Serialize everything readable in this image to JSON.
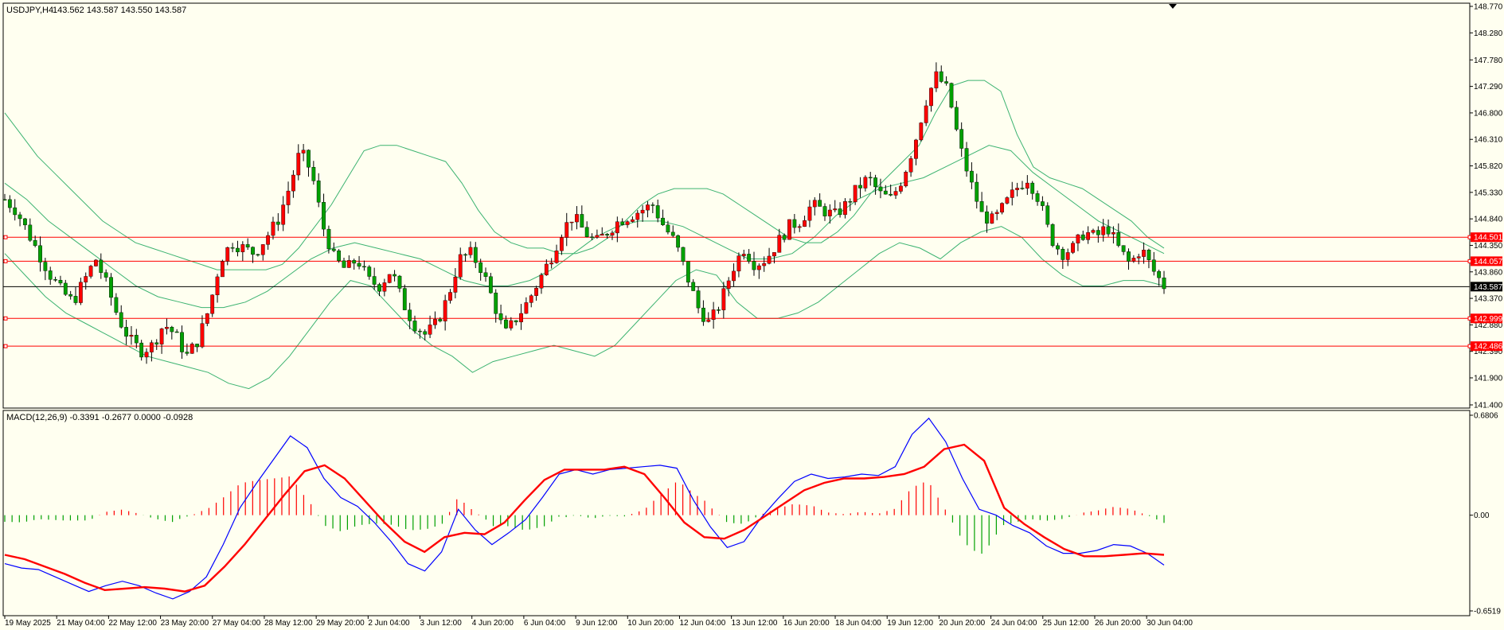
{
  "header": {
    "symbol_text": "USDJPY,H4",
    "ohlc_text": "143.562 143.587 143.550 143.587"
  },
  "macd_header": {
    "text": "MACD(12,26,9) -0.3391 -0.2677 0.0000 -0.0928"
  },
  "colors": {
    "background": "#fffff0",
    "bull_candle": "#ff0000",
    "bear_candle": "#00a000",
    "bands": "#3cb371",
    "levels": "#ff0000",
    "price_line": "#000000",
    "macd_line": "#0000ff",
    "signal_line": "#ff0000",
    "hist_positive": "#ff0000",
    "hist_negative": "#00a000"
  },
  "chart_data": [
    {
      "type": "candlestick",
      "title": "USDJPY,H4",
      "timeframe": "H4",
      "ylim": [
        141.4,
        148.77
      ],
      "y_ticks": [
        "148.770",
        "148.280",
        "147.780",
        "147.290",
        "146.800",
        "146.310",
        "145.820",
        "145.330",
        "144.840",
        "144.350",
        "143.860",
        "143.370",
        "142.880",
        "142.390",
        "141.900",
        "141.400"
      ],
      "x_ticks": [
        "19 May 2025",
        "21 May 04:00",
        "22 May 12:00",
        "23 May 20:00",
        "27 May 04:00",
        "28 May 12:00",
        "29 May 20:00",
        "2 Jun 04:00",
        "3 Jun 12:00",
        "4 Jun 20:00",
        "6 Jun 04:00",
        "9 Jun 12:00",
        "10 Jun 20:00",
        "12 Jun 04:00",
        "13 Jun 12:00",
        "16 Jun 20:00",
        "18 Jun 04:00",
        "19 Jun 12:00",
        "20 Jun 20:00",
        "24 Jun 04:00",
        "25 Jun 12:00",
        "26 Jun 20:00",
        "30 Jun 04:00"
      ],
      "levels": [
        {
          "price": 144.501,
          "label": "144.501"
        },
        {
          "price": 144.057,
          "label": "144.057"
        },
        {
          "price": 142.999,
          "label": "142.999"
        },
        {
          "price": 142.486,
          "label": "142.486"
        }
      ],
      "current_price": {
        "price": 143.587,
        "label": "143.587"
      },
      "price_path": [
        145.2,
        145.0,
        144.6,
        144.2,
        143.8,
        143.5,
        143.3,
        143.7,
        144.1,
        143.6,
        143.0,
        142.6,
        142.4,
        142.5,
        142.9,
        142.7,
        142.3,
        142.6,
        143.2,
        144.1,
        144.4,
        144.3,
        144.2,
        144.5,
        144.8,
        145.4,
        146.1,
        145.7,
        144.7,
        144.1,
        143.9,
        144.1,
        143.7,
        143.6,
        143.9,
        143.3,
        142.9,
        142.7,
        142.9,
        143.4,
        144.1,
        144.2,
        143.9,
        143.3,
        142.7,
        143.0,
        143.3,
        143.7,
        144.1,
        144.6,
        144.9,
        144.6,
        144.4,
        144.6,
        144.8,
        144.9,
        145.0,
        145.1,
        144.7,
        144.4,
        143.8,
        143.2,
        142.9,
        143.3,
        143.9,
        144.3,
        144.0,
        144.1,
        144.4,
        144.7,
        144.8,
        145.1,
        145.0,
        144.9,
        145.1,
        145.4,
        145.6,
        145.3,
        145.2,
        145.6,
        146.2,
        147.0,
        147.5,
        147.2,
        146.2,
        145.5,
        144.9,
        144.8,
        145.1,
        145.4,
        145.6,
        145.2,
        144.5,
        144.2,
        144.3,
        144.6,
        144.5,
        144.7,
        144.3,
        144.0,
        144.3,
        143.9,
        143.6
      ],
      "bollinger": {
        "upper_path": [
          146.8,
          146.4,
          146.0,
          145.7,
          145.4,
          145.1,
          144.8,
          144.6,
          144.4,
          144.3,
          144.2,
          144.1,
          144.0,
          143.9,
          143.9,
          143.9,
          143.9,
          144.0,
          144.3,
          144.7,
          145.1,
          145.6,
          146.1,
          146.2,
          146.2,
          146.1,
          146.0,
          145.9,
          145.5,
          145.0,
          144.6,
          144.4,
          144.3,
          144.3,
          144.2,
          144.2,
          144.3,
          144.5,
          144.8,
          145.1,
          145.3,
          145.4,
          145.4,
          145.4,
          145.3,
          145.1,
          144.9,
          144.7,
          144.5,
          144.4,
          144.4,
          144.6,
          144.9,
          145.3,
          145.6,
          145.9,
          146.2,
          146.8,
          147.3,
          147.4,
          147.4,
          147.2,
          146.4,
          145.8,
          145.6,
          145.5,
          145.4,
          145.2,
          145.0,
          144.8,
          144.5,
          144.3
        ],
        "middle_path": [
          145.5,
          145.2,
          144.8,
          144.5,
          144.2,
          143.9,
          143.6,
          143.4,
          143.3,
          143.2,
          143.2,
          143.3,
          143.5,
          143.8,
          144.1,
          144.3,
          144.4,
          144.3,
          144.2,
          144.1,
          143.9,
          143.7,
          143.6,
          143.6,
          143.7,
          143.9,
          144.2,
          144.5,
          144.7,
          144.8,
          144.8,
          144.7,
          144.5,
          144.3,
          144.1,
          144.1,
          144.2,
          144.5,
          144.9,
          145.2,
          145.4,
          145.5,
          145.6,
          145.8,
          146.0,
          146.2,
          146.1,
          145.7,
          145.4,
          145.1,
          144.8,
          144.6,
          144.4,
          144.2
        ],
        "lower_path": [
          144.2,
          143.8,
          143.4,
          143.1,
          142.9,
          142.7,
          142.5,
          142.3,
          142.2,
          142.1,
          142.0,
          141.8,
          141.7,
          141.9,
          142.3,
          142.8,
          143.3,
          143.7,
          143.6,
          143.2,
          142.8,
          142.5,
          142.3,
          142.0,
          142.2,
          142.3,
          142.4,
          142.5,
          142.4,
          142.3,
          142.5,
          142.9,
          143.3,
          143.7,
          143.9,
          143.8,
          143.3,
          143.0,
          143.0,
          143.1,
          143.3,
          143.6,
          143.9,
          144.2,
          144.4,
          144.3,
          144.1,
          144.4,
          144.6,
          144.7,
          144.5,
          144.1,
          143.8,
          143.6,
          143.6,
          143.7,
          143.7,
          143.6
        ]
      }
    },
    {
      "type": "macd",
      "title": "MACD(12,26,9)",
      "parameters": [
        12,
        26,
        9
      ],
      "values": {
        "macd": -0.3391,
        "signal": -0.2677,
        "value3": 0.0,
        "histogram": -0.0928
      },
      "ylim": [
        -0.6519,
        0.6806
      ],
      "y_ticks": [
        "0.6806",
        "0.00",
        "-0.6519"
      ],
      "macd_path": [
        -0.33,
        -0.36,
        -0.37,
        -0.42,
        -0.47,
        -0.52,
        -0.48,
        -0.45,
        -0.48,
        -0.53,
        -0.57,
        -0.52,
        -0.42,
        -0.2,
        0.05,
        0.22,
        0.38,
        0.54,
        0.46,
        0.25,
        0.12,
        0.06,
        -0.05,
        -0.18,
        -0.33,
        -0.38,
        -0.25,
        0.04,
        -0.1,
        -0.2,
        -0.12,
        -0.03,
        0.12,
        0.28,
        0.31,
        0.28,
        0.31,
        0.32,
        0.33,
        0.34,
        0.32,
        0.1,
        -0.08,
        -0.22,
        -0.18,
        -0.02,
        0.11,
        0.23,
        0.28,
        0.25,
        0.26,
        0.28,
        0.27,
        0.33,
        0.55,
        0.66,
        0.5,
        0.25,
        0.04,
        0.0,
        -0.07,
        -0.12,
        -0.21,
        -0.26,
        -0.26,
        -0.24,
        -0.2,
        -0.21,
        -0.26,
        -0.34
      ],
      "signal_path": [
        -0.27,
        -0.3,
        -0.35,
        -0.4,
        -0.46,
        -0.51,
        -0.5,
        -0.49,
        -0.5,
        -0.52,
        -0.48,
        -0.35,
        -0.2,
        -0.03,
        0.14,
        0.3,
        0.34,
        0.25,
        0.1,
        -0.05,
        -0.18,
        -0.25,
        -0.15,
        -0.12,
        -0.13,
        -0.05,
        0.1,
        0.24,
        0.31,
        0.31,
        0.31,
        0.33,
        0.28,
        0.12,
        -0.05,
        -0.15,
        -0.16,
        -0.1,
        -0.01,
        0.08,
        0.17,
        0.22,
        0.25,
        0.25,
        0.26,
        0.28,
        0.33,
        0.45,
        0.48,
        0.37,
        0.05,
        -0.06,
        -0.15,
        -0.23,
        -0.28,
        -0.28,
        -0.27,
        -0.26,
        -0.27
      ]
    }
  ]
}
